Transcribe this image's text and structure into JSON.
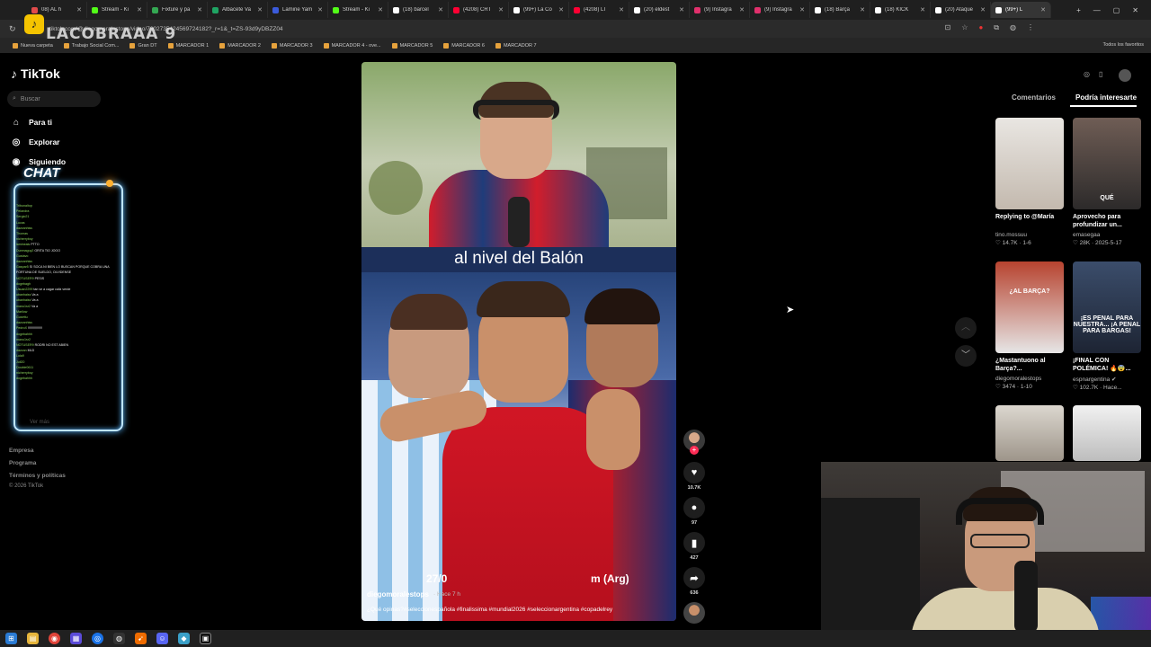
{
  "browser": {
    "tabs": [
      {
        "title": "08) AL h",
        "color": "#e04b4b"
      },
      {
        "title": "Stream - Ki",
        "color": "#53fc18"
      },
      {
        "title": "Fixture y pa",
        "color": "#34a853"
      },
      {
        "title": "Albacete Va",
        "color": "#1fa463"
      },
      {
        "title": "Lamine Yam",
        "color": "#3b5bdb"
      },
      {
        "title": "Stream - Ki",
        "color": "#53fc18"
      },
      {
        "title": "(18) barcel",
        "color": "#ffffff"
      },
      {
        "title": "(4208) CRT",
        "color": "#ff0033"
      },
      {
        "title": "(99+) La Co",
        "color": "#ffffff"
      },
      {
        "title": "(4208) LT",
        "color": "#ff0033"
      },
      {
        "title": "(20) eldest",
        "color": "#ffffff"
      },
      {
        "title": "(9) Instagra",
        "color": "#e1306c"
      },
      {
        "title": "(9) Instagra",
        "color": "#e1306c"
      },
      {
        "title": "(18) Barça",
        "color": "#ffffff"
      },
      {
        "title": "(18) KICK",
        "color": "#ffffff"
      },
      {
        "title": "(20) Ataque",
        "color": "#ffffff"
      },
      {
        "title": "(99+) L",
        "color": "#ffffff"
      }
    ],
    "url": "tiktok.com/@diegomoralestops/video/7602735424569724182?_r=1&_t=ZS-93d9yDBZZ04",
    "bookmarks": [
      "Nueva carpeta",
      "Trabajo Social Com...",
      "Gran DT",
      "MARCADOR 1",
      "MARCADOR 2",
      "MARCADOR 3",
      "MARCADOR 4 - ove...",
      "MARCADOR 5",
      "MARCADOR 6",
      "MARCADOR 7"
    ],
    "all_bookmarks": "Todos los favoritos"
  },
  "overlay": {
    "streamer_name": "LACOBRAAA 9",
    "chat_title": "CHAT",
    "chat_more": "Ver más",
    "chat_lines": [
      {
        "user": "Tribunaltop",
        "msg": ""
      },
      {
        "user": "Pelandra",
        "msg": ""
      },
      {
        "user": "Sergio21",
        "msg": ""
      },
      {
        "user": "Lucas",
        "msg": ""
      },
      {
        "user": "dazzanhiss",
        "msg": ""
      },
      {
        "user": "Thomas",
        "msg": ""
      },
      {
        "user": "nicherryboy",
        "msg": ""
      },
      {
        "user": "lamineals",
        "msg": "PTTO"
      },
      {
        "user": "Dunmaguy2",
        "msg": "GRITA TIO JOOO"
      },
      {
        "user": "Gustavo",
        "msg": ""
      },
      {
        "user": "dazzanhiss",
        "msg": ""
      },
      {
        "user": "Gaspar5",
        "msg": "SI SOCA NI BIEN LO BUSCAN PORQUE COBRA UNA"
      },
      {
        "user": "",
        "msg": "FORTUNA DE SUELDO, OLVIDENSE"
      },
      {
        "user": "NOTUSER9",
        "msg": "PESIS"
      },
      {
        "user": "dogebagh",
        "msg": ""
      },
      {
        "user": "Usuan2299",
        "msg": "tan ve a cagar caliz verde"
      },
      {
        "user": "ubanhaiss",
        "msg": "Va a"
      },
      {
        "user": "ubanhaiss",
        "msg": "Va a"
      },
      {
        "user": "manu1sr2",
        "msg": "Va a"
      },
      {
        "user": "Marilow",
        "msg": ""
      },
      {
        "user": "Gusettu",
        "msg": ""
      },
      {
        "user": "dazzanhiss",
        "msg": ""
      },
      {
        "user": "PedroX",
        "msg": "!!!!!!!!!!!!!!!!"
      },
      {
        "user": "dogebahhh",
        "msg": ""
      },
      {
        "user": "manu1sr2",
        "msg": ""
      },
      {
        "user": "NOTUSER9",
        "msg": "RODRI NO EST ABIEN"
      },
      {
        "user": "dazzan",
        "msg": "MLD"
      },
      {
        "user": "Lola9",
        "msg": ""
      },
      {
        "user": "Juli20",
        "msg": ""
      },
      {
        "user": "Double0611",
        "msg": ""
      },
      {
        "user": "nicherryboy",
        "msg": ""
      },
      {
        "user": "dogebahhh",
        "msg": ""
      }
    ]
  },
  "tiktok": {
    "logo": "TikTok",
    "search_placeholder": "Buscar",
    "nav": [
      {
        "label": "Para ti",
        "icon": "home-icon"
      },
      {
        "label": "Explorar",
        "icon": "compass-icon"
      },
      {
        "label": "Siguiendo",
        "icon": "following-icon"
      }
    ],
    "footer": [
      "Empresa",
      "Programa",
      "Términos y políticas",
      "© 2026 TikTok"
    ],
    "video": {
      "caption": "al nivel del Balón",
      "date_text": "27/0",
      "tz_text": "m (Arg)",
      "author": "diegomoralestops",
      "time": "· Hace 7 h",
      "description": "¿Qué opinas?#seleccionespañola #finalissima #mundial2026 #seleccionargentina #copadelrey"
    },
    "actions": {
      "likes": "10.7K",
      "comments": "97",
      "saves": "427",
      "shares": "636"
    },
    "panel": {
      "tab_comments": "Comentarios",
      "tab_interest": "Podría interesarte",
      "cards": [
        {
          "title": "Replying to @María",
          "author": "tino.mossuu",
          "stats": "♡ 14.7K · 1-6",
          "overlay": "",
          "thumb": [
            "#e9e6e2",
            "#c3b9ae"
          ]
        },
        {
          "title": "Aprovecho para profundizar un...",
          "author": "emasegaa",
          "stats": "♡ 28K · 2025-5-17",
          "overlay": "QUÉ",
          "thumb": [
            "#6f5d55",
            "#2c2a2a"
          ]
        },
        {
          "title": "¿Mastantuono al Barça?...",
          "author": "diegomoralestops",
          "stats": "♡ 3474 · 1-10",
          "overlay": "¿AL BARÇA?",
          "thumb": [
            "#b7432f",
            "#e6e6e6"
          ]
        },
        {
          "title": "¡FINAL CON POLÉMICA! 🔥😨...",
          "author": "espnargentina ✔",
          "stats": "♡ 102.7K · Hace...",
          "overlay": "¡ES PENAL PARA NUESTRA... ¡A PENAL PARA BARGAS!",
          "thumb": [
            "#3b4d6b",
            "#1d2433"
          ]
        },
        {
          "title": "",
          "author": "",
          "stats": "",
          "overlay": "",
          "thumb": [
            "#dcd7cf",
            "#9e958a"
          ]
        },
        {
          "title": "",
          "author": "",
          "stats": "",
          "overlay": "",
          "thumb": [
            "#f1f1f1",
            "#bdbdbd"
          ]
        }
      ]
    }
  }
}
